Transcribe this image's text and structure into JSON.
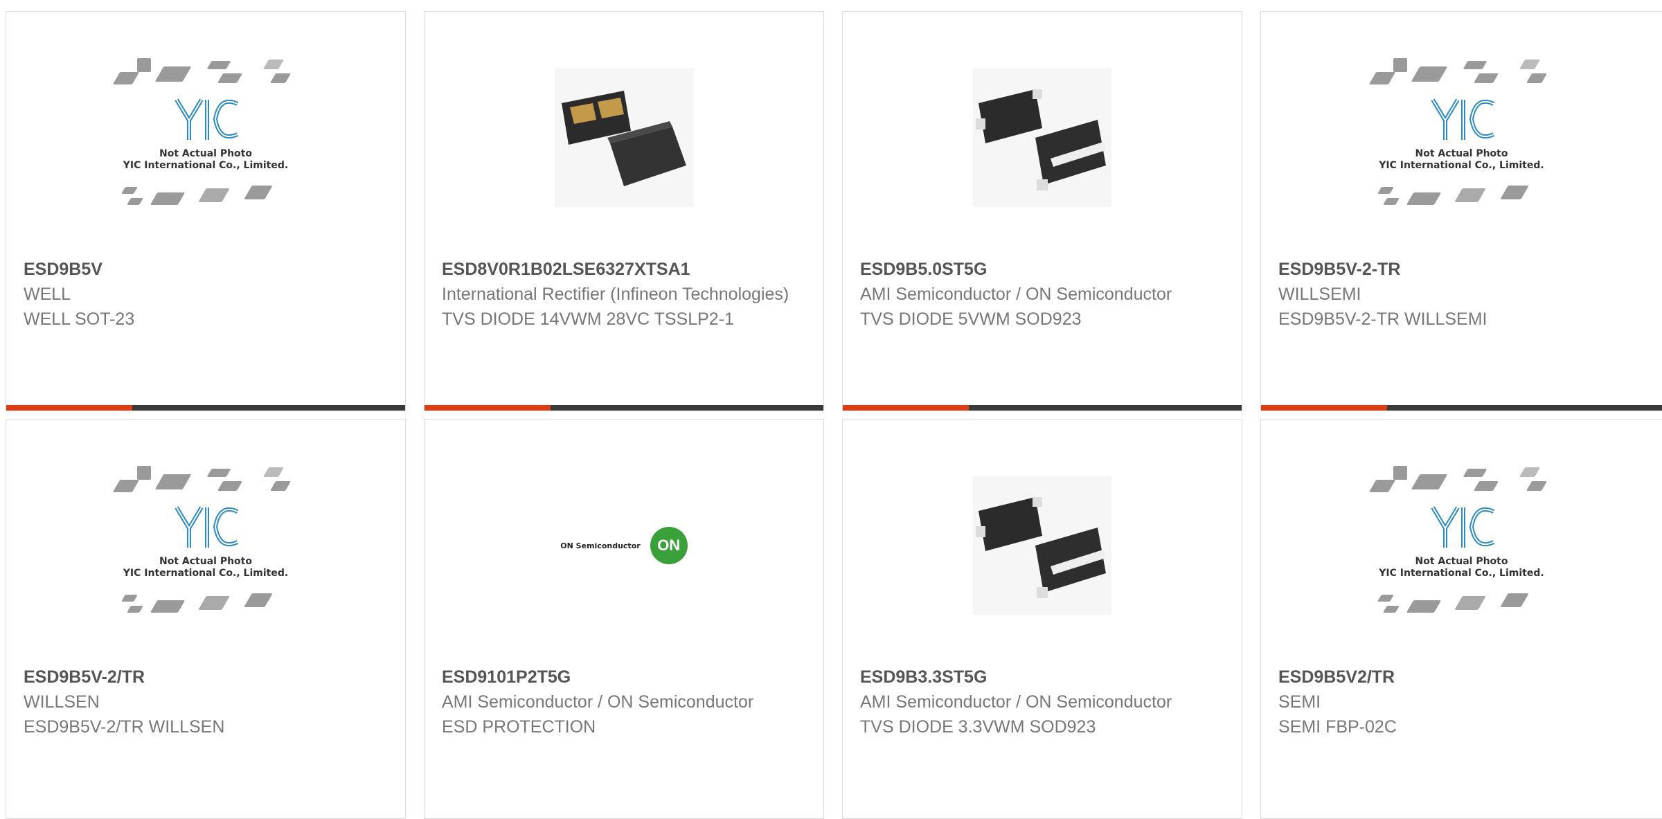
{
  "placeholder": {
    "line1": "Not Actual Photo",
    "line2": "YIC International Co., Limited.",
    "logo": "YIC"
  },
  "on_logo": {
    "name": "ON Semiconductor",
    "circle": "ON"
  },
  "products": [
    {
      "part": "ESD9B5V",
      "manufacturer": "WELL",
      "description": "WELL SOT-23",
      "image": "yic-placeholder"
    },
    {
      "part": "ESD8V0R1B02LSE6327XTSA1",
      "manufacturer": "International Rectifier (Infineon Technologies)",
      "description": "TVS DIODE 14VWM 28VC TSSLP2-1",
      "image": "tsslp-photo"
    },
    {
      "part": "ESD9B5.0ST5G",
      "manufacturer": "AMI Semiconductor / ON Semiconductor",
      "description": "TVS DIODE 5VWM SOD923",
      "image": "sod923-photo"
    },
    {
      "part": "ESD9B5V-2-TR",
      "manufacturer": "WILLSEMI",
      "description": "ESD9B5V-2-TR WILLSEMI",
      "image": "yic-placeholder"
    },
    {
      "part": "ESD9B5V-2/TR",
      "manufacturer": "WILLSEN",
      "description": "ESD9B5V-2/TR WILLSEN",
      "image": "yic-placeholder"
    },
    {
      "part": "ESD9101P2T5G",
      "manufacturer": "AMI Semiconductor / ON Semiconductor",
      "description": "ESD PROTECTION",
      "image": "on-semi-logo"
    },
    {
      "part": "ESD9B3.3ST5G",
      "manufacturer": "AMI Semiconductor / ON Semiconductor",
      "description": "TVS DIODE 3.3VWM SOD923",
      "image": "sod923-photo"
    },
    {
      "part": "ESD9B5V2/TR",
      "manufacturer": "SEMI",
      "description": "SEMI FBP-02C",
      "image": "yic-placeholder"
    }
  ],
  "colors": {
    "accent": "#e03c14",
    "bar": "#3a3a3a",
    "yic_blue": "#2a8ac4"
  }
}
